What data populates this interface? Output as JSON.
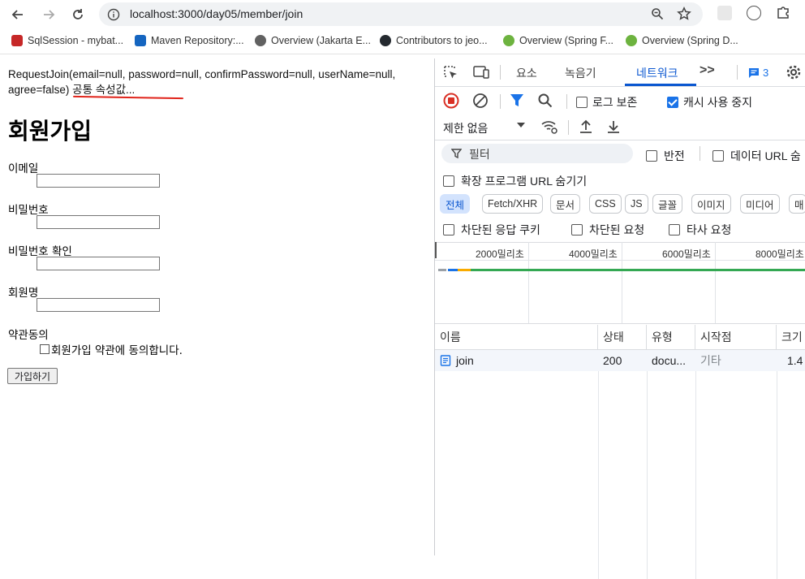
{
  "browser": {
    "url": "localhost:3000/day05/member/join",
    "bookmarks": [
      {
        "label": "SqlSession - mybat...",
        "color": "#c62828"
      },
      {
        "label": "Maven Repository:...",
        "color": "#1565c0"
      },
      {
        "label": "Overview (Jakarta E...",
        "color": "#616161"
      },
      {
        "label": "Contributors to jeo...",
        "color": "#24292f"
      },
      {
        "label": "Overview (Spring F...",
        "color": "#6db33f"
      },
      {
        "label": "Overview (Spring D...",
        "color": "#6db33f"
      }
    ]
  },
  "page": {
    "request_text": "RequestJoin(email=null, password=null, confirmPassword=null, userName=null, agree=false) 공통 속성값...",
    "title": "회원가입",
    "email_label": "이메일",
    "password_label": "비밀번호",
    "confirm_label": "비밀번호 확인",
    "name_label": "회원명",
    "agree_section_label": "약관동의",
    "agree_text": "회원가입 약관에 동의합니다.",
    "submit_label": "가입하기"
  },
  "devtools": {
    "tabs": [
      "요소",
      "녹음기",
      "네트워크"
    ],
    "active_tab": "네트워크",
    "more_tabs": ">>",
    "message_count": "3",
    "preserve_log": "로그 보존",
    "disable_cache": "캐시 사용 중지",
    "throttle": "제한 없음",
    "filter_placeholder": "필터",
    "invert": "반전",
    "hide_data_urls": "데이터 URL 숨",
    "hide_ext_urls": "확장 프로그램 URL 숨기기",
    "type_filters": [
      "전체",
      "Fetch/XHR",
      "문서",
      "CSS",
      "JS",
      "글꼴",
      "이미지",
      "미디어",
      "매"
    ],
    "blocked_cookies": "차단된 응답 쿠키",
    "blocked_requests": "차단된 요청",
    "third_party": "타사 요청",
    "timeline_ticks": [
      "2000밀리초",
      "4000밀리초",
      "6000밀리초",
      "8000밀리초"
    ],
    "columns": [
      "이름",
      "상태",
      "유형",
      "시작점",
      "크기"
    ],
    "rows": [
      {
        "name": "join",
        "status": "200",
        "type": "docu...",
        "initiator": "기타",
        "size": "1.4"
      }
    ]
  }
}
